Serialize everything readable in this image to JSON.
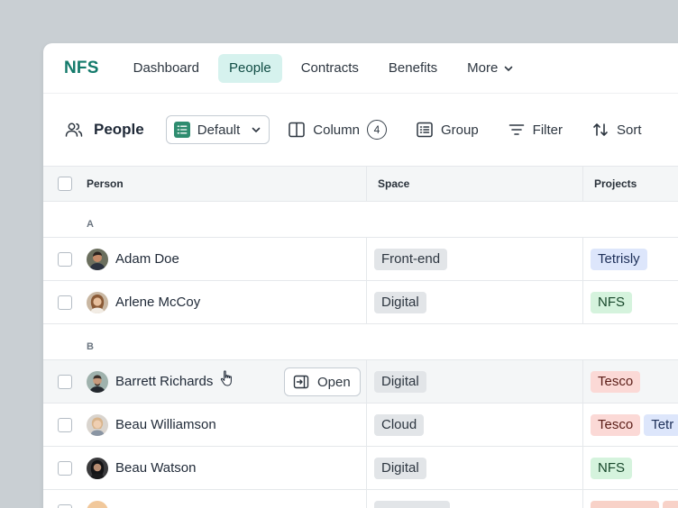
{
  "app": {
    "logo": "NFS"
  },
  "nav": [
    {
      "label": "Dashboard",
      "active": false
    },
    {
      "label": "People",
      "active": true
    },
    {
      "label": "Contracts",
      "active": false
    },
    {
      "label": "Benefits",
      "active": false
    },
    {
      "label": "More",
      "active": false
    }
  ],
  "toolbar": {
    "title": "People",
    "view_label": "Default",
    "column_label": "Column",
    "column_count": "4",
    "group_label": "Group",
    "filter_label": "Filter",
    "sort_label": "Sort"
  },
  "table": {
    "headers": {
      "person": "Person",
      "space": "Space",
      "projects": "Projects"
    },
    "groups": [
      {
        "letter": "A"
      },
      {
        "letter": "B"
      }
    ],
    "rows": [
      {
        "name": "Adam Doe",
        "space": "Front-end",
        "projects": [
          "Tetrisly"
        ]
      },
      {
        "name": "Arlene McCoy",
        "space": "Digital",
        "projects": [
          "NFS"
        ]
      },
      {
        "name": "Barrett Richards",
        "space": "Digital",
        "projects": [
          "Tesco"
        ],
        "open_label": "Open"
      },
      {
        "name": "Beau Williamson",
        "space": "Cloud",
        "projects": [
          "Tesco",
          "Tetr"
        ]
      },
      {
        "name": "Beau Watson",
        "space": "Digital",
        "projects": [
          "NFS"
        ]
      }
    ]
  },
  "colors": {
    "brand": "#137a6b",
    "nav_active_bg": "#d6f2ee",
    "pill_grey": "#e2e5e8",
    "pill_blue": "#dde6fb",
    "pill_green": "#d5f3dd",
    "pill_red": "#fbd9d6"
  }
}
